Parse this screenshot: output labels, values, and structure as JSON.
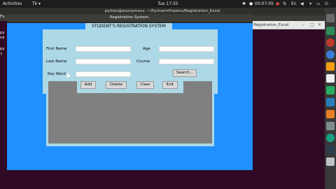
{
  "topbar": {
    "activities": "Activities",
    "app_menu": "Tk ▾",
    "clock": "Tue 17:55",
    "recording_time": "00:07:05"
  },
  "terminal": {
    "title": "python@anonymous: ~/PycharmProjects/Registration_Excel",
    "lines": [
      "Fi",
      "py",
      "ne",
      "py",
      "▯"
    ]
  },
  "pycharm": {
    "tab": "Registration_Excel"
  },
  "tkwindow": {
    "title": "Registration System.",
    "heading": "STUDENT'S REGISTRATION SYSTEM",
    "fields": {
      "first_name": {
        "label": "First Name",
        "value": ""
      },
      "age": {
        "label": "Age",
        "value": ""
      },
      "last_name": {
        "label": "Last Name",
        "value": ""
      },
      "course": {
        "label": "Course",
        "value": ""
      },
      "key_word": {
        "label": "Key Word",
        "value": ""
      }
    },
    "search_label": "Search...",
    "buttons": {
      "add": "Add",
      "delete": "Delete",
      "clear": "Clear",
      "exit": "Exit"
    }
  },
  "colors": {
    "window_bg": "#1e90ff",
    "panel_bg": "#add8e6",
    "table_bg": "#808080"
  }
}
